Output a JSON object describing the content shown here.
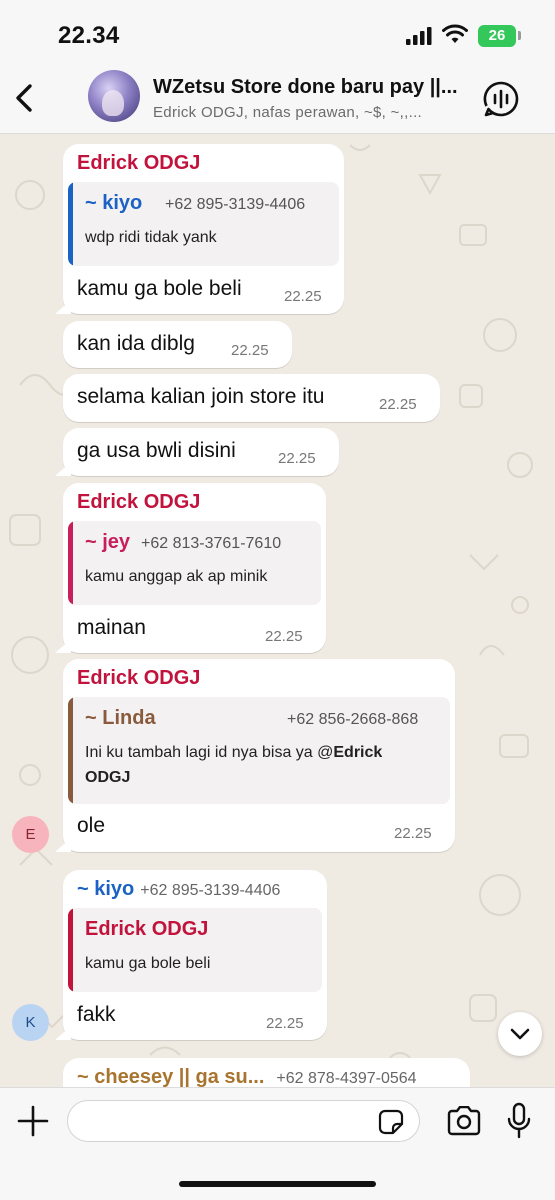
{
  "status_bar": {
    "time": "22.34",
    "battery": "26"
  },
  "header": {
    "title": "WZetsu Store done baru pay ||...",
    "subtitle": "Edrick ODGJ, nafas perawan, ~$, ~,,..."
  },
  "colors": {
    "chat_bg": "#efeae2",
    "sender_red": "#c2133d",
    "kiyo_blue": "#1b62c4",
    "jey_pink": "#c81e5b",
    "linda_brown": "#8a5a3c",
    "cheesey_gold": "#a8742e",
    "battery_green": "#34c759"
  },
  "messages": [
    {
      "sender": "Edrick ODGJ",
      "quote": {
        "author": "~ kiyo",
        "phone": "+62 895-3139-4406",
        "text": "wdp ridi tidak yank"
      },
      "text": "kamu ga bole beli",
      "time": "22.25"
    },
    {
      "text": "kan ida diblg",
      "time": "22.25"
    },
    {
      "text": "selama kalian join store itu",
      "time": "22.25"
    },
    {
      "text": "ga usa bwli disini",
      "time": "22.25"
    },
    {
      "sender": "Edrick ODGJ",
      "quote": {
        "author": "~ jey",
        "phone": "+62 813-3761-7610",
        "text": "kamu anggap ak ap minik"
      },
      "text": "mainan",
      "time": "22.25"
    },
    {
      "sender": "Edrick ODGJ",
      "quote": {
        "author": "~ Linda",
        "phone": "+62 856-2668-868",
        "text_pre": "Ini ku tambah lagi id nya bisa ya @",
        "mention_1": "Edrick",
        "mention_2": "ODGJ"
      },
      "text": "ole",
      "time": "22.25",
      "avatar_initial": "E"
    },
    {
      "sender": "~ kiyo",
      "sender_phone": "+62 895-3139-4406",
      "quote": {
        "author": "Edrick ODGJ",
        "text": "kamu ga bole beli"
      },
      "text": "fakk",
      "time": "22.25",
      "avatar_initial": "K"
    },
    {
      "sender": "~ cheesey || ga su...",
      "sender_phone": "+62 878-4397-0564"
    }
  ],
  "composer": {
    "placeholder": ""
  },
  "icons": {
    "back": "chevron-left-icon",
    "call": "group-call-icon",
    "scroll": "chevron-down-icon",
    "plus": "plus-icon",
    "sticker": "sticker-icon",
    "camera": "camera-icon",
    "mic": "microphone-icon"
  }
}
